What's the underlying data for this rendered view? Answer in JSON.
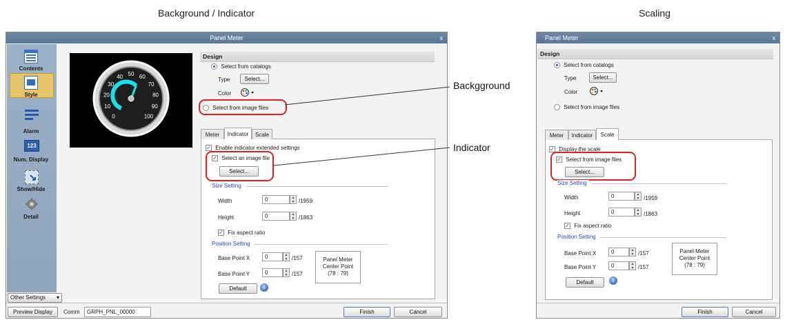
{
  "captions": {
    "left": "Background / Indicator",
    "right": "Scaling"
  },
  "callouts": {
    "background": "Backgground",
    "indicator": "Indicator"
  },
  "dialog_left": {
    "title": "Panel Meter",
    "close": "x",
    "sidebar": [
      {
        "label": "Contents",
        "icon": "contents-icon"
      },
      {
        "label": "Style",
        "icon": "style-icon"
      },
      {
        "label": "Alarm",
        "icon": "alarm-icon"
      },
      {
        "label": "Num. Display",
        "icon": "num-display-icon",
        "icon_text": "123"
      },
      {
        "label": "Show/Hide",
        "icon": "cursor-icon"
      },
      {
        "label": "Detail",
        "icon": "gear-icon"
      }
    ],
    "other_settings": "Other Settings",
    "preview_display": "Preview Display",
    "comm_label": "Comm",
    "comm_value": "GRPH_PNL_00000",
    "gauge_ticks": [
      "0",
      "10",
      "20",
      "30",
      "40",
      "50",
      "60",
      "70",
      "80",
      "90",
      "100"
    ],
    "design": {
      "header": "Design",
      "select_from_catalogs": "Select from catalogs",
      "type_label": "Type",
      "type_button": "Select...",
      "color_label": "Color",
      "select_from_image_files": "Select from image files"
    },
    "tabs": [
      "Meter",
      "Indicator",
      "Scale"
    ],
    "active_tab": "Indicator",
    "indicator": {
      "enable_extended": "Enable indicator extended settings",
      "select_image_file": "Select an image file",
      "select_button": "Select...",
      "size_setting": "Size Setting",
      "width_label": "Width",
      "width_value": "0",
      "width_max": "/1959",
      "height_label": "Height",
      "height_value": "0",
      "height_max": "/1863",
      "fix_aspect": "Fix aspect ratio",
      "position_setting": "Position Setting",
      "base_x_label": "Base Point X",
      "base_x_value": "0",
      "base_x_max": "/157",
      "base_y_label": "Base Point Y",
      "base_y_value": "0",
      "base_y_max": "/157",
      "center_point_line1": "Panel Meter",
      "center_point_line2": "Center Point",
      "center_point_line3": "(78 : 79)",
      "default_button": "Default"
    },
    "finish": "Finish",
    "cancel": "Cancel"
  },
  "dialog_right": {
    "title": "Panel Meter",
    "close": "x",
    "design": {
      "header": "Design",
      "select_from_catalogs": "Select from catalogs",
      "type_label": "Type",
      "type_button": "Select...",
      "color_label": "Color",
      "select_from_image_files": "Select from image files"
    },
    "tabs": [
      "Meter",
      "Indicator",
      "Scale"
    ],
    "active_tab": "Scale",
    "scale": {
      "display_scale": "Display the scale",
      "select_from_image_files": "Select from image files",
      "select_button": "Select...",
      "size_setting": "Size Setting",
      "width_label": "Width",
      "width_value": "0",
      "width_max": "/1959",
      "height_label": "Height",
      "height_value": "0",
      "height_max": "/1863",
      "fix_aspect": "Fix aspect ratio",
      "position_setting": "Position Setting",
      "base_x_label": "Base Point X",
      "base_x_value": "0",
      "base_x_max": "/157",
      "base_y_label": "Base Point Y",
      "base_y_value": "0",
      "base_y_max": "/157",
      "center_point_line1": "Panel Meter",
      "center_point_line2": "Center Point",
      "center_point_line3": "(78 : 79)",
      "default_button": "Default"
    },
    "finish": "Finish",
    "cancel": "Cancel"
  },
  "colors": {
    "titlebar": "#6580a3",
    "highlight": "#e02020",
    "group_label": "#1f49b6",
    "gauge_needle": "#19e0e8"
  }
}
